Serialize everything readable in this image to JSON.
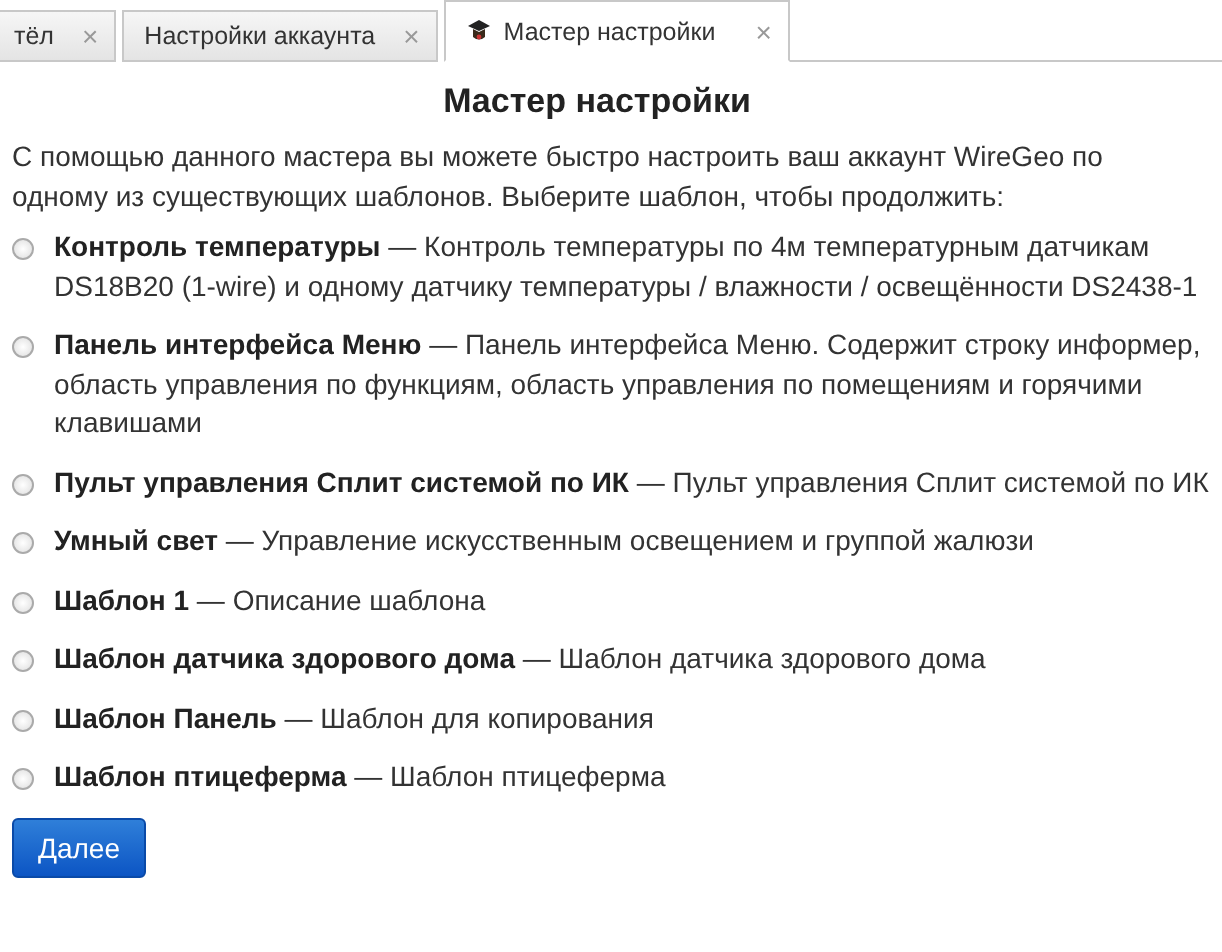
{
  "tabs": [
    {
      "label": "тёл",
      "close": "×",
      "selected": false,
      "icon": false
    },
    {
      "label": "Настройки аккаунта",
      "close": "×",
      "selected": false,
      "icon": false
    },
    {
      "label": "Мастер настройки",
      "close": "×",
      "selected": true,
      "icon": true
    }
  ],
  "title": "Мастер настройки",
  "intro": "С помощью данного мастера вы можете быстро настроить ваш аккаунт WireGeo по одному из существующих шаблонов. Выберите шаблон, чтобы продолжить:",
  "options": [
    {
      "label": "**Контроль температуры** — Контроль температуры по 4м температурным датчикам DS18B20 (1-wire) и одному датчику температуры / влажности / освещённости DS2438-1",
      "selected": false
    },
    {
      "label": "**Панель интерфейса Меню** — Панель интерфейса Меню. Содержит строку информер, область управления по функциям, область управления по помещениям и горячими клавишами",
      "selected": false
    },
    {
      "label": "**Пульт управления Сплит системой по ИК** — Пульт управления Сплит системой по ИК",
      "selected": false
    },
    {
      "label": "**Умный свет** — Управление искусственным освещением и группой жалюзи",
      "selected": false
    },
    {
      "label": "**Шаблон 1** — Описание шаблона",
      "selected": false
    },
    {
      "label": "**Шаблон датчика здорового дома** — Шаблон датчика здорового дома",
      "selected": false
    },
    {
      "label": "**Шаблон Панель** — Шаблон для копирования",
      "selected": false
    },
    {
      "label": "**Шаблон птицеферма** — Шаблон птицеферма",
      "selected": false
    }
  ],
  "button": "Далее"
}
